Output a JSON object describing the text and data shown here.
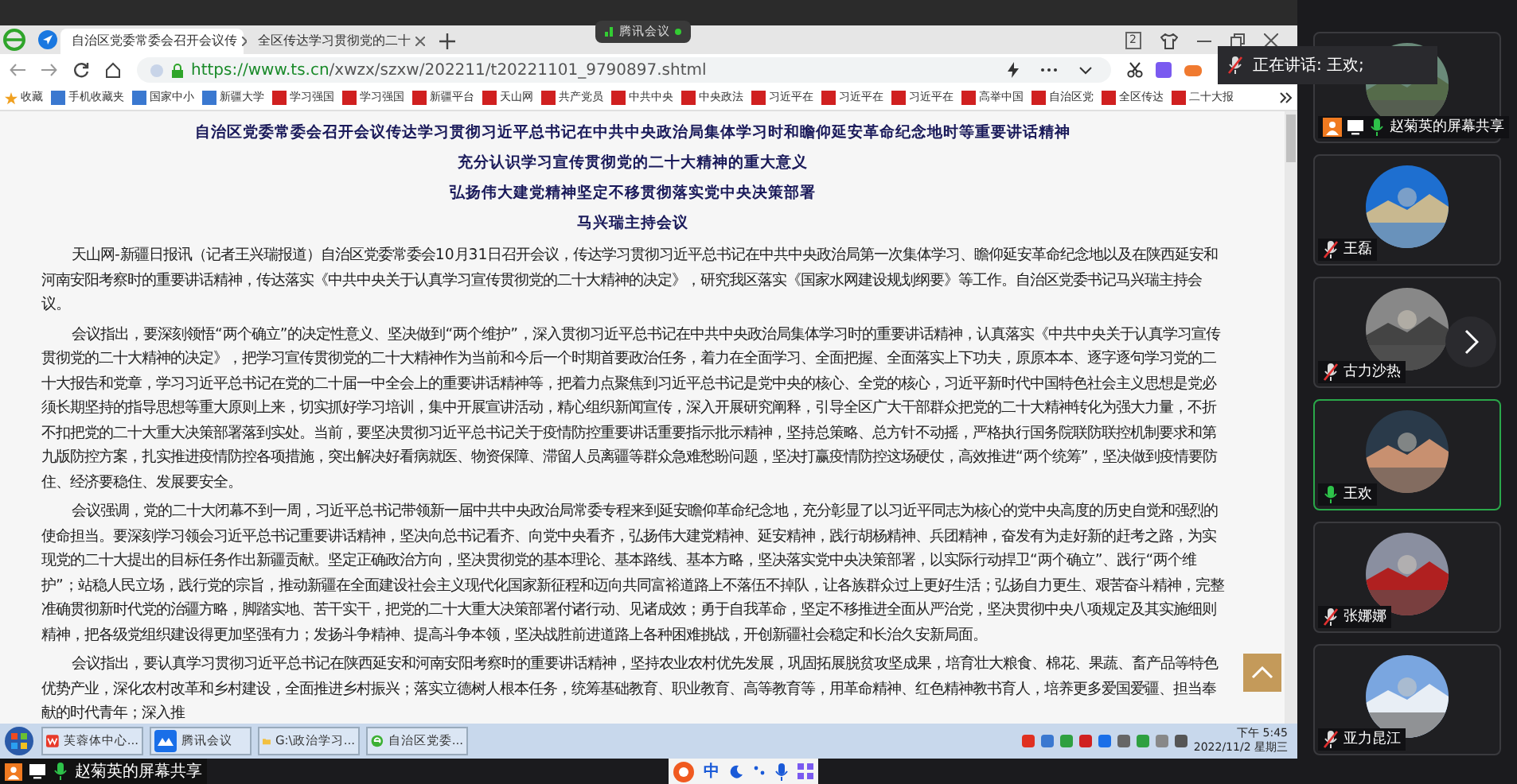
{
  "meeting_badge": "腾讯会议",
  "browser": {
    "tabs": [
      {
        "label": "自治区党委常委会召开会议传",
        "selected": true
      },
      {
        "label": "全区传达学习贯彻党的二十",
        "selected": false
      }
    ],
    "tab_count": "2",
    "url_prefix": "https://www.ts.cn",
    "url_rest": "/xwzx/szxw/202211/t20221101_9790897.shtml",
    "bookmarks": [
      "收藏",
      "手机收藏夹",
      "国家中小",
      "新疆大学",
      "学习强国",
      "学习强国",
      "新疆平台",
      "天山网",
      "共产党员",
      "中共中央",
      "中央政法",
      "习近平在",
      "习近平在",
      "习近平在",
      "高举中国",
      "自治区党",
      "全区传达",
      "二十大报"
    ]
  },
  "article": {
    "headings": [
      "自治区党委常委会召开会议传达学习贯彻习近平总书记在中共中央政治局集体学习时和瞻仰延安革命纪念地时等重要讲话精神",
      "充分认识学习宣传贯彻党的二十大精神的重大意义",
      "弘扬伟大建党精神坚定不移贯彻落实党中央决策部署",
      "马兴瑞主持会议"
    ],
    "paragraphs": [
      "天山网-新疆日报讯（记者王兴瑞报道）自治区党委常委会10月31日召开会议，传达学习贯彻习近平总书记在中共中央政治局第一次集体学习、瞻仰延安革命纪念地以及在陕西延安和河南安阳考察时的重要讲话精神，传达落实《中共中央关于认真学习宣传贯彻党的二十大精神的决定》，研究我区落实《国家水网建设规划纲要》等工作。自治区党委书记马兴瑞主持会议。",
      "会议指出，要深刻领悟“两个确立”的决定性意义、坚决做到“两个维护”，深入贯彻习近平总书记在中共中央政治局集体学习时的重要讲话精神，认真落实《中共中央关于认真学习宣传贯彻党的二十大精神的决定》，把学习宣传贯彻党的二十大精神作为当前和今后一个时期首要政治任务，着力在全面学习、全面把握、全面落实上下功夫，原原本本、逐字逐句学习党的二十大报告和党章，学习习近平总书记在党的二十届一中全会上的重要讲话精神等，把着力点聚焦到习近平总书记是党中央的核心、全党的核心，习近平新时代中国特色社会主义思想是党必须长期坚持的指导思想等重大原则上来，切实抓好学习培训，集中开展宣讲活动，精心组织新闻宣传，深入开展研究阐释，引导全区广大干部群众把党的二十大精神转化为强大力量，不折不扣把党的二十大重大决策部署落到实处。当前，要坚决贯彻习近平总书记关于疫情防控重要讲话重要指示批示精神，坚持总策略、总方针不动摇，严格执行国务院联防联控机制要求和第九版防控方案，扎实推进疫情防控各项措施，突出解决好看病就医、物资保障、滞留人员离疆等群众急难愁盼问题，坚决打赢疫情防控这场硬仗，高效推进“两个统筹”，坚决做到疫情要防住、经济要稳住、发展要安全。",
      "会议强调，党的二十大闭幕不到一周，习近平总书记带领新一届中共中央政治局常委专程来到延安瞻仰革命纪念地，充分彰显了以习近平同志为核心的党中央高度的历史自觉和强烈的使命担当。要深刻学习领会习近平总书记重要讲话精神，坚决向总书记看齐、向党中央看齐，弘扬伟大建党精神、延安精神，践行胡杨精神、兵团精神，奋发有为走好新的赶考之路，为实现党的二十大提出的目标任务作出新疆贡献。坚定正确政治方向，坚决贯彻党的基本理论、基本路线、基本方略，坚决落实党中央决策部署，以实际行动捍卫“两个确立”、践行“两个维护”；站稳人民立场，践行党的宗旨，推动新疆在全面建设社会主义现代化国家新征程和迈向共同富裕道路上不落伍不掉队，让各族群众过上更好生活；弘扬自力更生、艰苦奋斗精神，完整准确贯彻新时代党的治疆方略，脚踏实地、苦干实干，把党的二十大重大决策部署付诸行动、见诸成效；勇于自我革命，坚定不移推进全面从严治党，坚决贯彻中央八项规定及其实施细则精神，把各级党组织建设得更加坚强有力；发扬斗争精神、提高斗争本领，坚决战胜前进道路上各种困难挑战，开创新疆社会稳定和长治久安新局面。",
      "会议指出，要认真学习贯彻习近平总书记在陕西延安和河南安阳考察时的重要讲话精神，坚持农业农村优先发展，巩固拓展脱贫攻坚成果，培育壮大粮食、棉花、果蔬、畜产品等特色优势产业，深化农村改革和乡村建设，全面推进乡村振兴；落实立德树人根本任务，统筹基础教育、职业教育、高等教育等，用革命精神、红色精神教书育人，培养更多爱国爱疆、担当奉献的时代青年；深入推"
    ]
  },
  "taskbar": {
    "items": [
      {
        "label": "芙蓉体中心...",
        "kind": "wps"
      },
      {
        "label": "腾讯会议",
        "kind": "meeting"
      },
      {
        "label": "G:\\政治学习...",
        "kind": "folder"
      },
      {
        "label": "自治区党委...",
        "kind": "browser"
      }
    ],
    "time": "下午 5:45",
    "date": "2022/11/2 星期三"
  },
  "share_bar": {
    "label": "赵菊英的屏幕共享"
  },
  "ime": {
    "mode": "中"
  },
  "speaking": "正在讲话: 王欢;",
  "participants": [
    {
      "name": "赵菊英的屏幕共享",
      "kind": "share",
      "muted": false,
      "selected": false
    },
    {
      "name": "王磊",
      "kind": "person",
      "muted": true,
      "selected": false
    },
    {
      "name": "古力沙热",
      "kind": "person",
      "muted": true,
      "selected": false
    },
    {
      "name": "王欢",
      "kind": "person",
      "muted": false,
      "selected": true
    },
    {
      "name": "张娜娜",
      "kind": "person",
      "muted": true,
      "selected": false
    },
    {
      "name": "亚力昆江",
      "kind": "person",
      "muted": true,
      "selected": false
    }
  ]
}
